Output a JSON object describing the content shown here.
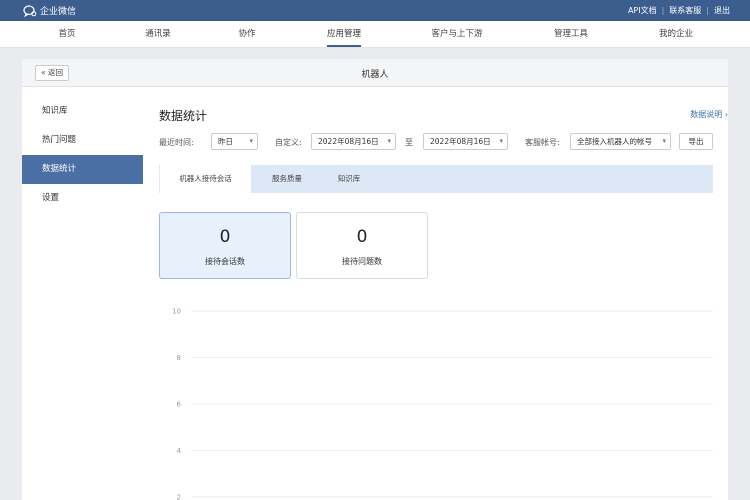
{
  "brand": {
    "name": "企业微信",
    "icon": "chat-bubble-icon"
  },
  "top_links": [
    "API文档",
    "联系客服",
    "退出"
  ],
  "nav": {
    "items": [
      "首页",
      "通讯录",
      "协作",
      "应用管理",
      "客户与上下游",
      "管理工具",
      "我的企业"
    ],
    "active_index": 3
  },
  "panel": {
    "back_label": "返回",
    "back_icon": "double-chevron-left-icon",
    "title": "机器人"
  },
  "sidebar": {
    "items": [
      "知识库",
      "热门问题",
      "数据统计",
      "设置"
    ],
    "active_index": 2
  },
  "main": {
    "title": "数据统计",
    "help_link": "数据说明",
    "help_icon": "chevron-right-icon"
  },
  "filters": {
    "recent_label": "最近时间:",
    "recent_value": "昨日",
    "custom_label": "自定义:",
    "start_date": "2022年08月16日",
    "to_label": "至",
    "end_date": "2022年08月16日",
    "account_label": "客服帐号:",
    "account_value": "全部接入机器人的帐号",
    "export_label": "导出"
  },
  "tabs": {
    "items": [
      "机器人接待会话",
      "服务质量",
      "知识库"
    ],
    "active_index": 0
  },
  "cards": [
    {
      "value": "0",
      "label": "接待会话数",
      "active": true
    },
    {
      "value": "0",
      "label": "接待问题数",
      "active": false
    }
  ],
  "chart_data": {
    "type": "line",
    "y_ticks": [
      "10",
      "8",
      "6",
      "4",
      "2"
    ],
    "ylim": [
      0,
      10
    ],
    "grid": true,
    "series": []
  },
  "colors": {
    "topbar": "#3b5e8f",
    "sidebar_active": "#4a6fa5",
    "link": "#3b6fb6",
    "tab_bar": "#dce8f6",
    "card_active": "#e8f0fc"
  }
}
